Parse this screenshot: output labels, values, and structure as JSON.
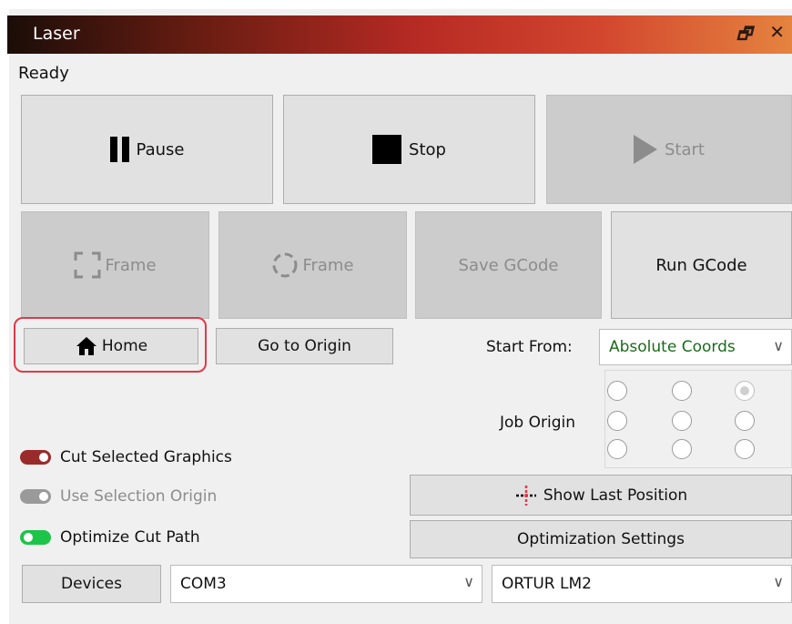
{
  "window": {
    "title": "Laser",
    "float_icon": "float-window-icon",
    "close_icon": "close-icon"
  },
  "status": {
    "text": "Ready"
  },
  "controls": {
    "pause_label": "Pause",
    "stop_label": "Stop",
    "start_label": "Start",
    "frame_rect_label": "Frame",
    "frame_circle_label": "Frame",
    "save_gcode_label": "Save GCode",
    "run_gcode_label": "Run GCode"
  },
  "positioning": {
    "home_label": "Home",
    "go_origin_label": "Go to Origin",
    "start_from_label": "Start From:",
    "start_from_value": "Absolute Coords",
    "job_origin_label": "Job Origin",
    "job_origin_selected": "top-right"
  },
  "options": {
    "cut_selected_label": "Cut Selected Graphics",
    "cut_selected_color": "#9a2b2b",
    "use_selection_origin_label": "Use Selection Origin",
    "use_selection_origin_color": "#9a9a9a",
    "optimize_cut_path_label": "Optimize Cut Path",
    "optimize_cut_path_color": "#1cc44a"
  },
  "actions": {
    "show_last_position_label": "Show Last Position",
    "optimization_settings_label": "Optimization Settings"
  },
  "device": {
    "devices_label": "Devices",
    "port_value": "COM3",
    "model_value": "ORTUR LM2"
  },
  "colors": {
    "text_green": "#1a6b1a",
    "highlight_red": "#e03a48"
  }
}
